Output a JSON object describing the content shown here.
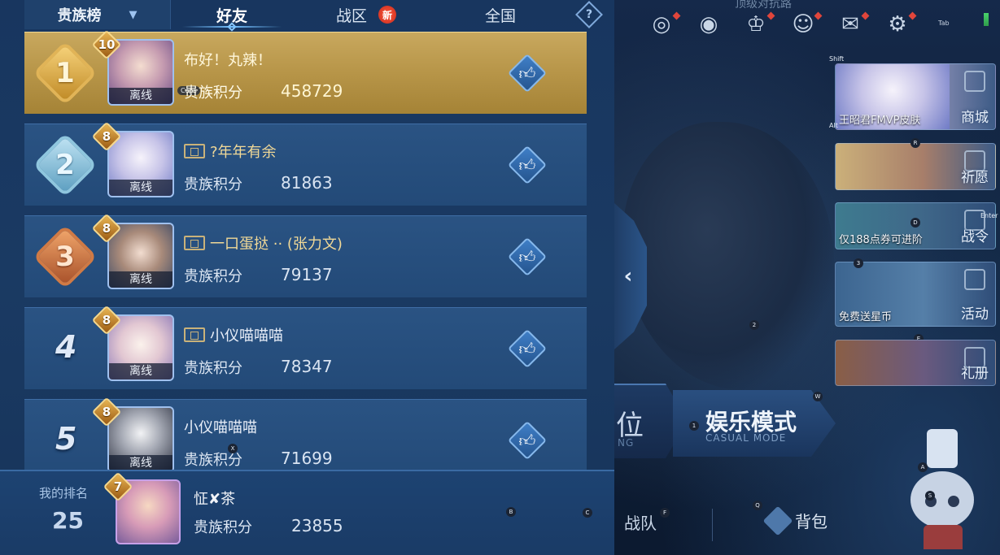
{
  "panel": {
    "dropdown_label": "贵族榜",
    "tabs": [
      {
        "label": "好友",
        "active": true
      },
      {
        "label": "战区",
        "badge": "新"
      },
      {
        "label": "全国"
      }
    ],
    "help_symbol": "?"
  },
  "rows": [
    {
      "rank": "1",
      "level": "10",
      "name": "布好！丸辣！",
      "score_label": "贵族积分",
      "score": "458729",
      "status": "离线",
      "caps_tag": "Caps"
    },
    {
      "rank": "2",
      "level": "8",
      "name": "?年年有余",
      "score_label": "贵族积分",
      "score": "81863",
      "status": "离线"
    },
    {
      "rank": "3",
      "level": "8",
      "name": "一口蛋挞 ·· (张力文)",
      "score_label": "贵族积分",
      "score": "79137",
      "status": "离线"
    },
    {
      "rank": "4",
      "level": "8",
      "name": "小仪喵喵喵",
      "score_label": "贵族积分",
      "score": "78347",
      "status": "离线"
    },
    {
      "rank": "5",
      "level": "8",
      "name": "小仪喵喵喵",
      "score_label": "贵族积分",
      "score": "71699",
      "status": "离线"
    }
  ],
  "my_rank": {
    "label": "我的排名",
    "rank": "25",
    "level": "7",
    "name": "怔✘茶",
    "score_label": "贵族积分",
    "score": "23855"
  },
  "lobby": {
    "top_title": "顶级对抗路",
    "tab_hint": "Tab",
    "side_cards": [
      {
        "label": "商城",
        "sub": "王昭君FMVP皮肤"
      },
      {
        "label": "祈愿",
        "sub": ""
      },
      {
        "label": "战令",
        "sub": "仅188点券可进阶"
      },
      {
        "label": "活动",
        "sub": "免费送星币"
      },
      {
        "label": "礼册",
        "sub": ""
      }
    ],
    "mode_ranked": {
      "big": "位",
      "small": "NG"
    },
    "mode_casual": {
      "big": "娱乐模式",
      "small": "CASUAL MODE"
    },
    "bottom_team": "战队",
    "bottom_bag": "背包",
    "key_hints": {
      "shift": "Shift",
      "alt": "Alt",
      "r": "R",
      "d": "D",
      "enter": "Enter",
      "three": "3",
      "two": "2",
      "e": "E",
      "w": "W",
      "one": "1",
      "a": "A",
      "s": "S",
      "q": "Q",
      "f": "F",
      "b": "B",
      "c": "C",
      "x": "X",
      "z": "Z"
    }
  },
  "colors": {
    "panel_bg": "#1a3a63",
    "row_bg": "#2a5383",
    "first_row_gold": "#b79548",
    "name_gold": "#f1d997",
    "accent_blue": "#74c0ff",
    "new_badge_red": "#e0453b"
  },
  "icons": {
    "dropdown": "chevron-down-icon",
    "help": "help-icon",
    "like": "thumbs-up-icon",
    "collapse": "chevron-left-icon",
    "top_bar": [
      "target-icon",
      "eye-icon",
      "trophy-icon",
      "friends-icon",
      "mail-icon",
      "gear-icon",
      "signal-icon"
    ]
  }
}
